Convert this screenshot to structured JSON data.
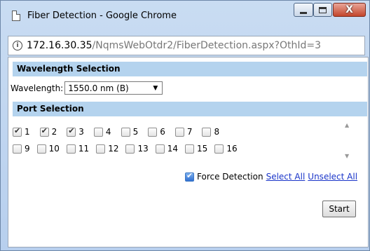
{
  "window": {
    "title": "Fiber Detection - Google Chrome",
    "close_glyph": "X"
  },
  "addressbar": {
    "info_glyph": "i",
    "host": "172.16.30.35",
    "path": "/NqmsWebOtdr2/FiberDetection.aspx?OthId=3"
  },
  "wavelength": {
    "section_title": "Wavelength Selection",
    "label": "Wavelength:",
    "selected": "1550.0 nm (B)"
  },
  "ports": {
    "section_title": "Port Selection",
    "row1": [
      {
        "label": "1",
        "checked": true
      },
      {
        "label": "2",
        "checked": true
      },
      {
        "label": "3",
        "checked": true
      },
      {
        "label": "4",
        "checked": false
      },
      {
        "label": "5",
        "checked": false
      },
      {
        "label": "6",
        "checked": false
      },
      {
        "label": "7",
        "checked": false
      },
      {
        "label": "8",
        "checked": false
      }
    ],
    "row2": [
      {
        "label": "9",
        "checked": false
      },
      {
        "label": "10",
        "checked": false
      },
      {
        "label": "11",
        "checked": false
      },
      {
        "label": "12",
        "checked": false
      },
      {
        "label": "13",
        "checked": false
      },
      {
        "label": "14",
        "checked": false
      },
      {
        "label": "15",
        "checked": false
      },
      {
        "label": "16",
        "checked": false
      }
    ]
  },
  "controls": {
    "force_detection_label": "Force Detection",
    "force_detection_checked": true,
    "select_all": "Select All",
    "unselect_all": "Unselect All",
    "start": "Start"
  }
}
